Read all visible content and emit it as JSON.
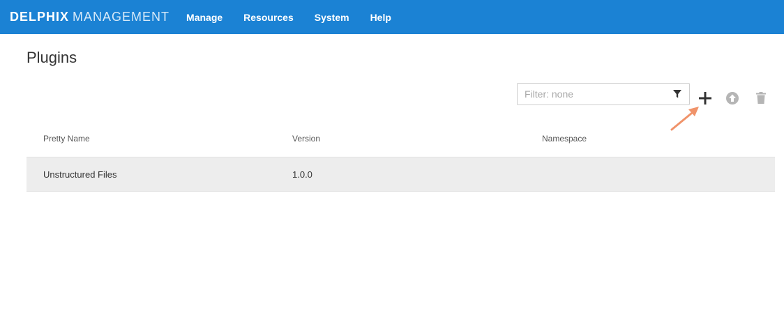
{
  "header": {
    "brand_bold": "DELPHIX",
    "brand_light": "MANAGEMENT",
    "nav": [
      "Manage",
      "Resources",
      "System",
      "Help"
    ]
  },
  "page": {
    "title": "Plugins"
  },
  "toolbar": {
    "filter_placeholder": "Filter: none",
    "filter_value": ""
  },
  "table": {
    "columns": [
      "Pretty Name",
      "Version",
      "Namespace"
    ],
    "rows": [
      [
        "Unstructured Files",
        "1.0.0",
        ""
      ]
    ]
  },
  "colors": {
    "topbar": "#1b82d4",
    "row_highlight": "#ededed",
    "annotation_arrow": "#f0936a",
    "icon_muted": "#b5b5b5",
    "icon_active": "#333333"
  },
  "icons": {
    "filter": "filter-funnel",
    "add": "plus",
    "upload": "arrow-up-circle",
    "delete": "trash",
    "annotation": "pointing-arrow"
  }
}
